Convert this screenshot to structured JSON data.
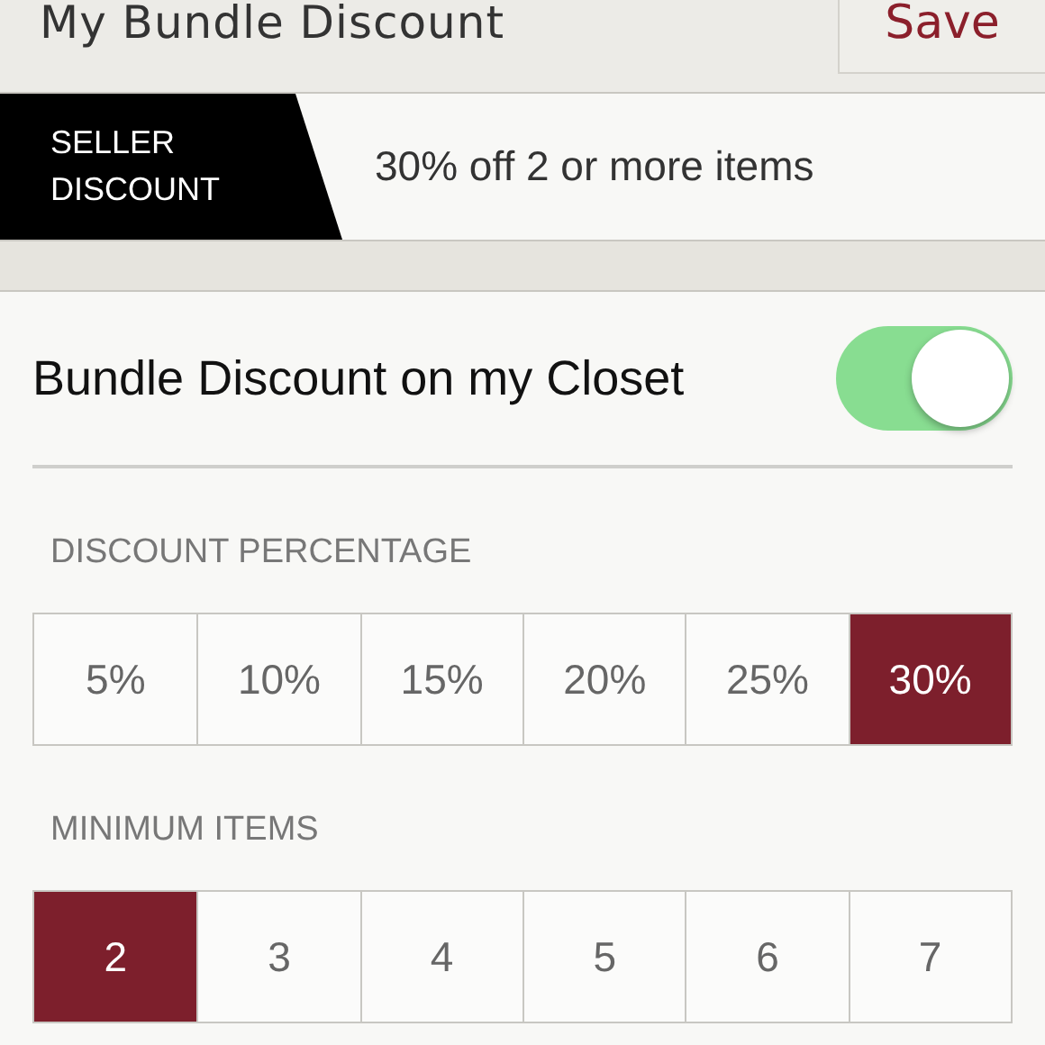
{
  "header": {
    "title": "My Bundle Discount",
    "save_button": "Save"
  },
  "banner": {
    "tag": "SELLER DISCOUNT",
    "summary": "30% off 2 or more items"
  },
  "bundle_toggle": {
    "label": "Bundle Discount on my Closet",
    "on": true
  },
  "sections": [
    {
      "title": "DISCOUNT PERCENTAGE",
      "options": [
        {
          "label": "5%",
          "selected": false
        },
        {
          "label": "10%",
          "selected": false
        },
        {
          "label": "15%",
          "selected": false
        },
        {
          "label": "20%",
          "selected": false
        },
        {
          "label": "25%",
          "selected": false
        },
        {
          "label": "30%",
          "selected": true
        }
      ]
    },
    {
      "title": "MINIMUM ITEMS",
      "options": [
        {
          "label": "2",
          "selected": true
        },
        {
          "label": "3",
          "selected": false
        },
        {
          "label": "4",
          "selected": false
        },
        {
          "label": "5",
          "selected": false
        },
        {
          "label": "6",
          "selected": false
        },
        {
          "label": "7",
          "selected": false
        }
      ]
    }
  ]
}
